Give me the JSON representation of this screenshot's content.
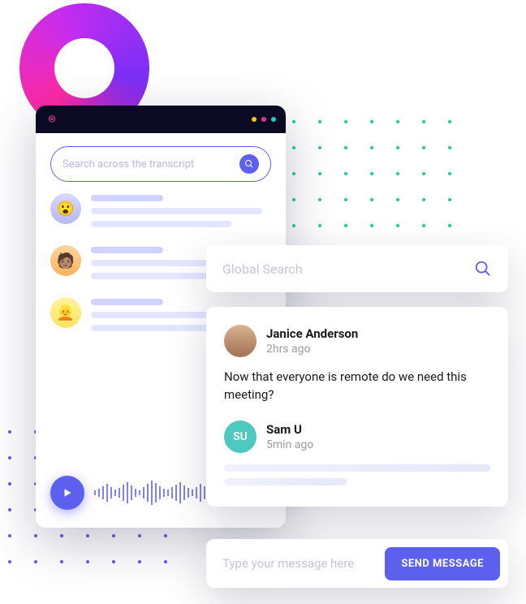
{
  "transcript_window": {
    "search_placeholder": "Search across the transcript",
    "entries": [
      {
        "avatar_name": "avatar-1"
      },
      {
        "avatar_name": "avatar-2"
      },
      {
        "avatar_name": "avatar-3"
      }
    ]
  },
  "global_search": {
    "placeholder": "Global Search"
  },
  "chat": {
    "messages": [
      {
        "name": "Janice Anderson",
        "time": "2hrs ago",
        "body": "Now that everyone is remote do we need this meeting?"
      },
      {
        "name": "Sam U",
        "initials": "SU",
        "time": "5min ago"
      }
    ]
  },
  "compose": {
    "placeholder": "Type your message here",
    "send_label": "SEND MESSAGE"
  }
}
